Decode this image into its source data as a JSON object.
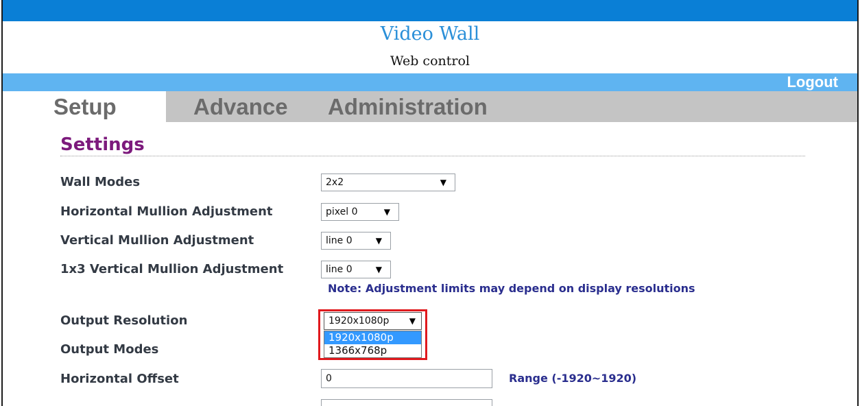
{
  "header": {
    "title": "Video Wall",
    "subtitle": "Web control",
    "logout_label": "Logout"
  },
  "tabs": [
    {
      "label": "Setup",
      "active": true
    },
    {
      "label": "Advance",
      "active": false
    },
    {
      "label": "Administration",
      "active": false
    }
  ],
  "section_title": "Settings",
  "fields": {
    "wall_modes": {
      "label": "Wall Modes",
      "value": "2x2"
    },
    "h_mullion": {
      "label": "Horizontal Mullion Adjustment",
      "value": "pixel 0"
    },
    "v_mullion": {
      "label": "Vertical Mullion Adjustment",
      "value": "line 0"
    },
    "v_mullion_1x3": {
      "label": "1x3 Vertical Mullion Adjustment",
      "value": "line 0"
    },
    "note": "Note: Adjustment limits may depend on display resolutions",
    "output_resolution": {
      "label": "Output Resolution",
      "value": "1920x1080p",
      "options": [
        "1920x1080p",
        "1366x768p"
      ],
      "highlighted_option": "1920x1080p"
    },
    "output_modes": {
      "label": "Output Modes"
    },
    "horizontal_offset": {
      "label": "Horizontal Offset",
      "value": "0",
      "range": "Range (-1920∼1920)"
    }
  },
  "icons": {
    "dropdown_arrow": "▼"
  },
  "colors": {
    "top_bar": "#0a7fd6",
    "nav_bar": "#5fb4f1",
    "tabs_bar": "#c4c4c4",
    "section_title": "#7c1a7c",
    "note_text": "#2a2e8e",
    "highlight_border": "#e0191d",
    "selected_option": "#3399ff"
  }
}
